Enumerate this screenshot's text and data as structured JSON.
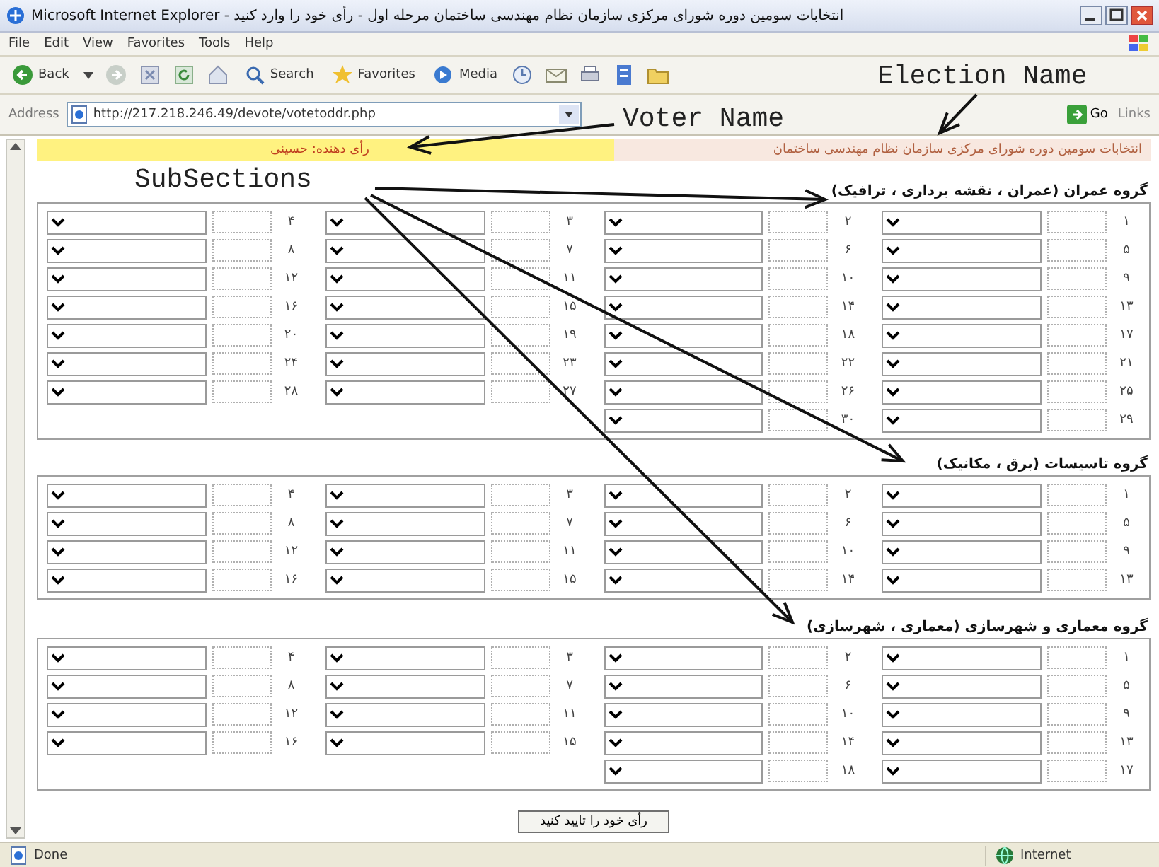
{
  "window": {
    "title": "انتخابات سومین دوره شورای مرکزی سازمان نظام مهندسی ساختمان مرحله اول - رأی خود را وارد کنید - Microsoft Internet Explorer"
  },
  "menu": [
    "File",
    "Edit",
    "View",
    "Favorites",
    "Tools",
    "Help"
  ],
  "toolbar": [
    {
      "kind": "back",
      "label": "Back"
    },
    {
      "kind": "forward"
    },
    {
      "kind": "stop"
    },
    {
      "kind": "refresh"
    },
    {
      "kind": "home"
    },
    {
      "kind": "search",
      "label": "Search"
    },
    {
      "kind": "favorites",
      "label": "Favorites"
    },
    {
      "kind": "media",
      "label": "Media"
    },
    {
      "kind": "history"
    },
    {
      "kind": "mail"
    },
    {
      "kind": "print"
    },
    {
      "kind": "edit"
    },
    {
      "kind": "folder"
    }
  ],
  "address": {
    "label": "Address",
    "url": "http://217.218.246.49/devote/votetoddr.php",
    "go": "Go",
    "links": "Links"
  },
  "page": {
    "voter": "رأی دهنده: حسینی",
    "election": "انتخابات سومین دوره شورای مرکزی سازمان نظام مهندسی ساختمان",
    "sections": [
      {
        "heading": "گروه عمران (عمران ، نقشه برداری ، ترافیک)",
        "rows": [
          [
            "۴",
            "۳",
            "۲",
            "۱"
          ],
          [
            "۸",
            "۷",
            "۶",
            "۵"
          ],
          [
            "۱۲",
            "۱۱",
            "۱۰",
            "۹"
          ],
          [
            "۱۶",
            "۱۵",
            "۱۴",
            "۱۳"
          ],
          [
            "۲۰",
            "۱۹",
            "۱۸",
            "۱۷"
          ],
          [
            "۲۴",
            "۲۳",
            "۲۲",
            "۲۱"
          ],
          [
            "۲۸",
            "۲۷",
            "۲۶",
            "۲۵"
          ],
          [
            "",
            "",
            "۳۰",
            "۲۹"
          ]
        ]
      },
      {
        "heading": "گروه تاسیسات (برق ، مکانیک)",
        "rows": [
          [
            "۴",
            "۳",
            "۲",
            "۱"
          ],
          [
            "۸",
            "۷",
            "۶",
            "۵"
          ],
          [
            "۱۲",
            "۱۱",
            "۱۰",
            "۹"
          ],
          [
            "۱۶",
            "۱۵",
            "۱۴",
            "۱۳"
          ]
        ]
      },
      {
        "heading": "گروه معماری و شهرسازی (معماری ، شهرسازی)",
        "rows": [
          [
            "۴",
            "۳",
            "۲",
            "۱"
          ],
          [
            "۸",
            "۷",
            "۶",
            "۵"
          ],
          [
            "۱۲",
            "۱۱",
            "۱۰",
            "۹"
          ],
          [
            "۱۶",
            "۱۵",
            "۱۴",
            "۱۳"
          ],
          [
            "",
            "",
            "۱۸",
            "۱۷"
          ]
        ]
      }
    ],
    "submit": "رأی خود را تایید کنید"
  },
  "annotations": [
    {
      "text": "Voter Name"
    },
    {
      "text": "Election Name"
    },
    {
      "text": "SubSections"
    }
  ],
  "status_bar": {
    "text": "Done",
    "zone": "Internet"
  }
}
